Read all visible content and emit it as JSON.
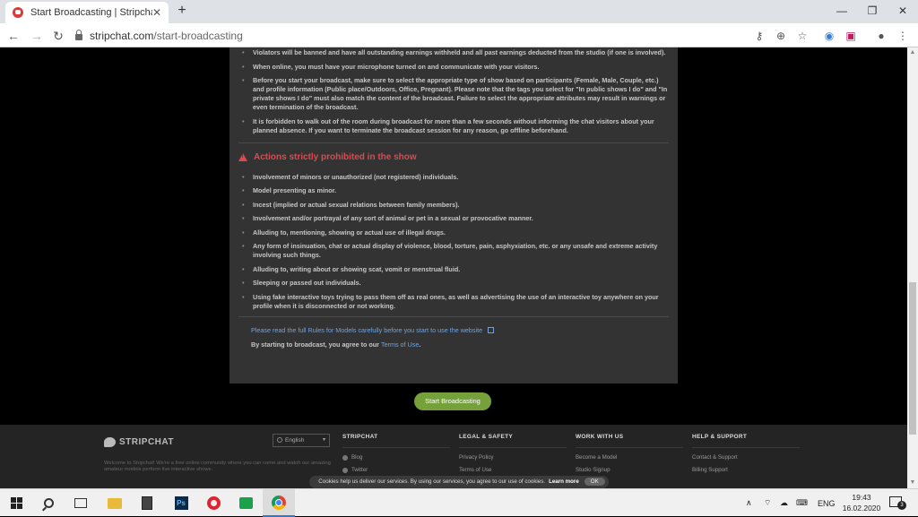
{
  "browser": {
    "tab_title": "Start Broadcasting | Stripchat",
    "tab_close": "✕",
    "new_tab": "+",
    "url_domain": "stripchat.com",
    "url_path": "/start-broadcasting",
    "win_minimize": "—",
    "win_maximize": "❐",
    "win_close": "✕"
  },
  "rules": {
    "top_items": [
      "Violators will be banned and have all outstanding earnings withheld and all past earnings deducted from the studio (if one is involved).",
      "When online, you must have your microphone turned on and communicate with your visitors.",
      "Before you start your broadcast, make sure to select the appropriate type of show based on participants (Female, Male, Couple, etc.) and profile information (Public place/Outdoors, Office, Pregnant). Please note that the tags you select for \"In public shows I do\" and \"In private shows I do\" must also match the content of the broadcast. Failure to select the appropriate attributes may result in warnings or even termination of the broadcast.",
      "It is forbidden to walk out of the room during broadcast for more than a few seconds without informing the chat visitors about your planned absence. If you want to terminate the broadcast session for any reason, go offline beforehand."
    ],
    "prohibited_heading": "Actions strictly prohibited in the show",
    "prohibited_items": [
      "Involvement of minors or unauthorized (not registered) individuals.",
      "Model presenting as minor.",
      "Incest (implied or actual sexual relations between family members).",
      "Involvement and/or portrayal of any sort of animal or pet in a sexual or provocative manner.",
      "Alluding to, mentioning, showing or actual use of illegal drugs.",
      "Any form of insinuation, chat or actual display of violence, blood, torture, pain, asphyxiation, etc. or any unsafe and extreme activity involving such things.",
      "Alluding to, writing about or showing scat, vomit or menstrual fluid.",
      "Sleeping or passed out individuals.",
      "Using fake interactive toys trying to pass them off as real ones, as well as advertising the use of an interactive toy anywhere on your profile when it is disconnected or not working."
    ],
    "read_rules_link": "Please read the full Rules for Models carefully before you start to use the website",
    "agree_prefix": "By starting to broadcast, you agree to our",
    "terms_link": "Terms of Use",
    "agree_suffix": "."
  },
  "start_button": "Start Broadcasting",
  "footer": {
    "logo_text": "STRIPCHAT",
    "description": "Welcome to Stripchat! We're a free online community where you can come and watch our amazing amateur models perform live interactive shows.",
    "language": "English",
    "columns": [
      {
        "title": "STRIPCHAT",
        "links": [
          "Blog",
          "Twitter"
        ]
      },
      {
        "title": "LEGAL & SAFETY",
        "links": [
          "Privacy Policy",
          "Terms of Use"
        ]
      },
      {
        "title": "WORK WITH US",
        "links": [
          "Become a Model",
          "Studio Signup"
        ]
      },
      {
        "title": "HELP & SUPPORT",
        "links": [
          "Contact & Support",
          "Billing Support"
        ]
      }
    ]
  },
  "cookie": {
    "text": "Cookies help us deliver our services. By using our services, you agree to our use of cookies.",
    "learn_more": "Learn more",
    "ok": "OK"
  },
  "taskbar": {
    "language": "ENG",
    "time": "19:43",
    "date": "16.02.2020",
    "notif_count": "3",
    "ps_label": "Ps"
  },
  "colors": {
    "accent_green": "#76a13a",
    "warning_red": "#e0484f",
    "link_blue": "#6fa3e0"
  }
}
